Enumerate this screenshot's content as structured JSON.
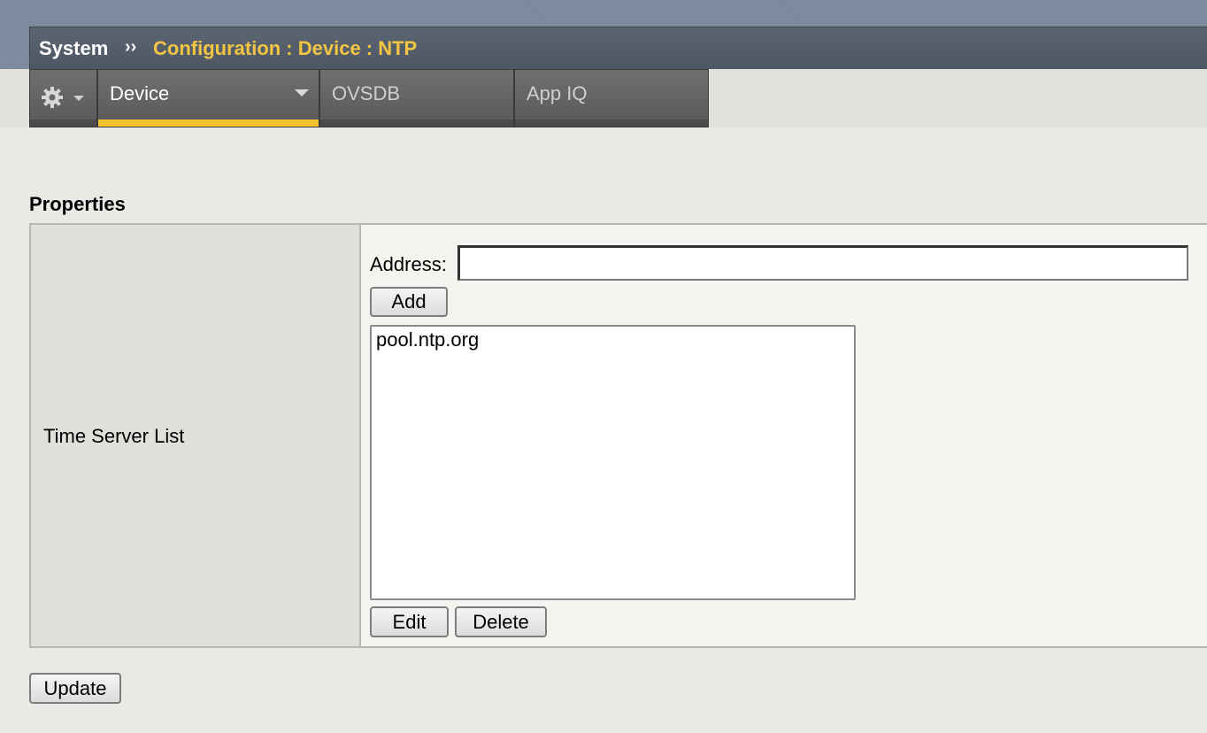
{
  "header": {
    "root": "System",
    "separator": "››",
    "path": "Configuration : Device : NTP"
  },
  "tabs": [
    {
      "label": "Device",
      "active": true
    },
    {
      "label": "OVSDB",
      "active": false
    },
    {
      "label": "App IQ",
      "active": false
    }
  ],
  "section": {
    "title": "Properties"
  },
  "time_servers": {
    "row_label": "Time Server List",
    "address_label": "Address:",
    "address_value": "",
    "add_label": "Add",
    "items": [
      "pool.ntp.org"
    ],
    "edit_label": "Edit",
    "delete_label": "Delete"
  },
  "footer": {
    "update_label": "Update"
  },
  "colors": {
    "accent": "#f2c543",
    "tab_active_underline": "#f5c232",
    "titlebar": "#555e6b"
  },
  "icons": {
    "settings": "gear-icon",
    "tab_menu": "chevron-down-icon"
  }
}
